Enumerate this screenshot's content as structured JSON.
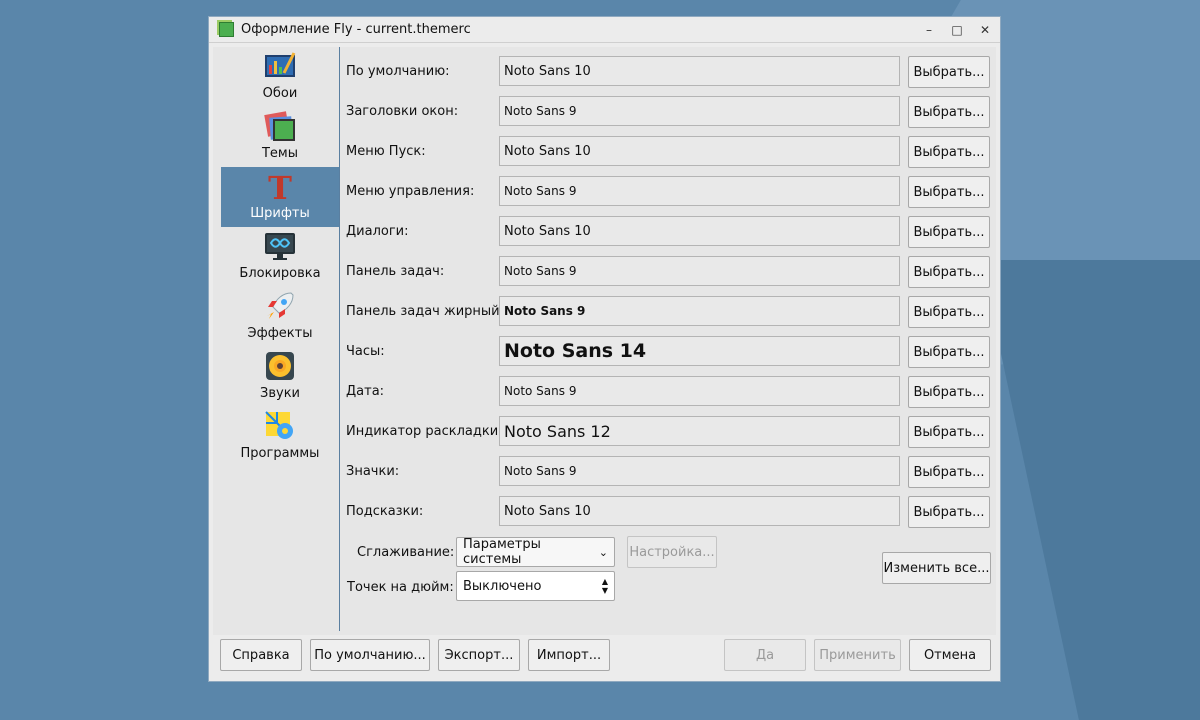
{
  "window": {
    "title": "Оформление Fly - current.themerc",
    "controls": {
      "minimize": "–",
      "maximize": "□",
      "close": "✕"
    }
  },
  "sidebar": {
    "items": [
      {
        "label": "Обои",
        "icon": "wallpaper-icon"
      },
      {
        "label": "Темы",
        "icon": "themes-icon"
      },
      {
        "label": "Шрифты",
        "icon": "fonts-icon",
        "active": true
      },
      {
        "label": "Блокировка",
        "icon": "lock-screen-icon"
      },
      {
        "label": "Эффекты",
        "icon": "rocket-icon"
      },
      {
        "label": "Звуки",
        "icon": "speaker-icon"
      },
      {
        "label": "Программы",
        "icon": "programs-icon"
      }
    ]
  },
  "fonts": [
    {
      "label": "По умолчанию:",
      "value": "Noto Sans 10",
      "size": 10,
      "bold": false
    },
    {
      "label": "Заголовки окон:",
      "value": "Noto Sans 9",
      "size": 9,
      "bold": false
    },
    {
      "label": "Меню Пуск:",
      "value": "Noto Sans 10",
      "size": 10,
      "bold": false
    },
    {
      "label": "Меню управления:",
      "value": "Noto Sans 9",
      "size": 9,
      "bold": false
    },
    {
      "label": "Диалоги:",
      "value": "Noto Sans 10",
      "size": 10,
      "bold": false
    },
    {
      "label": "Панель задач:",
      "value": "Noto Sans 9",
      "size": 9,
      "bold": false
    },
    {
      "label": "Панель задач жирный:",
      "value": "Noto Sans 9",
      "size": 9,
      "bold": true
    },
    {
      "label": "Часы:",
      "value": "Noto Sans 14",
      "size": 14,
      "bold": true
    },
    {
      "label": "Дата:",
      "value": "Noto Sans 9",
      "size": 9,
      "bold": false
    },
    {
      "label": "Индикатор раскладки:",
      "value": "Noto Sans 12",
      "size": 12,
      "bold": false
    },
    {
      "label": "Значки:",
      "value": "Noto Sans 9",
      "size": 9,
      "bold": false
    },
    {
      "label": "Подсказки:",
      "value": "Noto Sans 10",
      "size": 10,
      "bold": false
    }
  ],
  "choose_label": "Выбрать...",
  "smoothing": {
    "label": "Сглаживание:",
    "value": "Параметры системы",
    "settings_button": "Настройка..."
  },
  "dpi": {
    "label": "Точек на дюйм:",
    "value": "Выключено"
  },
  "change_all_label": "Изменить все...",
  "footer": {
    "help": "Справка",
    "defaults": "По умолчанию...",
    "export": "Экспорт...",
    "import": "Импорт...",
    "ok": "Да",
    "apply": "Применить",
    "cancel": "Отмена"
  }
}
